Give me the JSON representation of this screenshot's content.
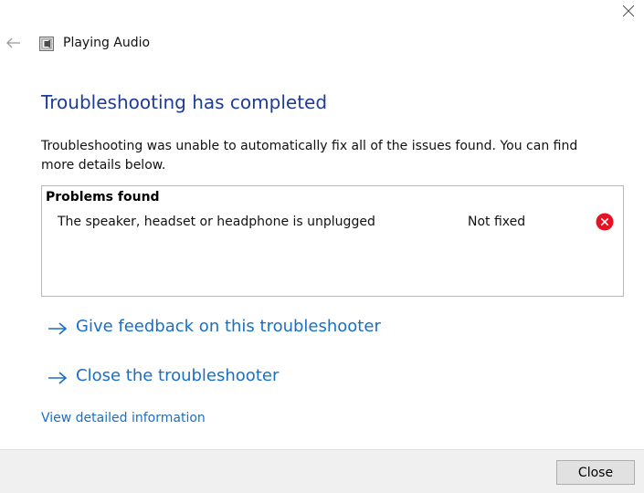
{
  "window": {
    "title": "Playing Audio"
  },
  "icons": {
    "close": "close-icon",
    "back": "back-arrow-icon",
    "app": "audio-troubleshooter-icon",
    "error": "error-icon",
    "link_arrow": "arrow-right-icon"
  },
  "main": {
    "heading": "Troubleshooting has completed",
    "description": "Troubleshooting was unable to automatically fix all of the issues found. You can find more details below."
  },
  "problems": {
    "header": "Problems found",
    "items": [
      {
        "description": "The speaker, headset or headphone is unplugged",
        "status": "Not fixed"
      }
    ]
  },
  "links": {
    "feedback": "Give feedback on this troubleshooter",
    "close": "Close the troubleshooter",
    "details": "View detailed information"
  },
  "footer": {
    "close_button": "Close"
  },
  "colors": {
    "heading": "#1e3c96",
    "link": "#1a6fc4",
    "error": "#e81123",
    "footer_bg": "#f0f0f0"
  }
}
